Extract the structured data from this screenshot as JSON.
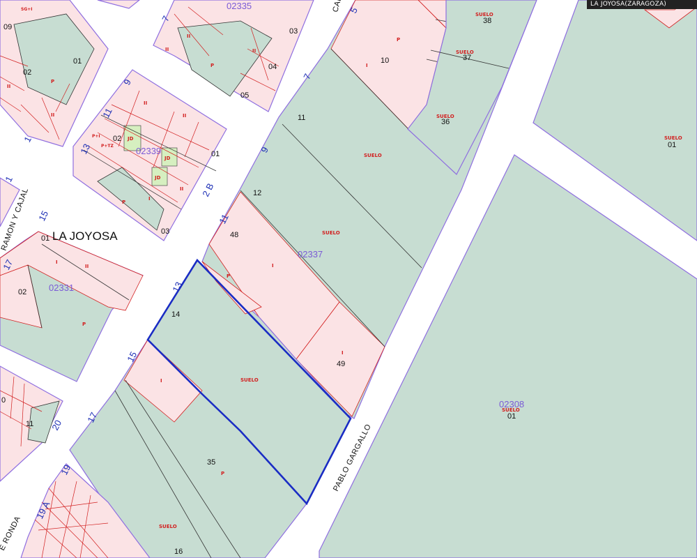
{
  "header": {
    "title": "LA JOYOSA(ZARAGOZA)"
  },
  "colors": {
    "background": "#ffffff",
    "parcel_green": "#c7ddd2",
    "parcel_pink": "#fbe3e5",
    "building_green": "#d6efc0",
    "block_outline": "#8f6fe0",
    "parcel_line": "#333333",
    "building_line": "#d21f1f",
    "selected_outline": "#1a2cc4",
    "street_label": "#111111",
    "block_label": "#7b5bd6",
    "portal_label": "#1d2fb5",
    "use_label": "#d21f1f"
  },
  "town_label": "LA JOYOSA",
  "streets": {
    "pablo_gargallo": "PABLO GARGALLO",
    "ramon_y_cajal": "RAMON Y CAJAL",
    "de_ronda": "E RONDA",
    "top_cut": "CAL"
  },
  "blocks": {
    "b02335": "02335",
    "b02339": "02339",
    "b02337": "02337",
    "b02331": "02331",
    "b02308": "02308"
  },
  "portal_numbers": {
    "p7_top": "7",
    "p5_top": "5",
    "p9_left": "9",
    "p11_left": "11",
    "p13_left": "13",
    "p7_mid": "7",
    "p9_mid": "9",
    "p11_mid": "11",
    "p13_mid": "13",
    "p15_mid": "15",
    "p17_mid": "17",
    "p2b": "2 B",
    "p15_left": "15",
    "p17_left": "17",
    "p20": "20",
    "p19": "19",
    "p19a": "19 A",
    "p1": "1",
    "p1_b": "1"
  },
  "parcel_numbers": {
    "n09": "09",
    "n02_a": "02",
    "n01_a": "01",
    "n03_a": "03",
    "n04_a": "04",
    "n05_a": "05",
    "n02_b": "02",
    "n01_b": "01",
    "n03_b": "03",
    "n01_c": "01",
    "n02_c": "02",
    "n10": "10",
    "n11": "11",
    "n12": "12",
    "n48": "48",
    "n14": "14",
    "n49": "49",
    "n35": "35",
    "n16": "16",
    "n38": "38",
    "n37": "37",
    "n36": "36",
    "n01_d": "01",
    "n01_e": "01",
    "n11_b": "11",
    "n0": "0"
  },
  "use_labels": {
    "suelo": "SUELO",
    "p": "P",
    "i": "I",
    "ii": "II",
    "jd": "JD",
    "sg_i": "SG+I",
    "p_i": "P+I",
    "p_tz": "P+TZ"
  }
}
